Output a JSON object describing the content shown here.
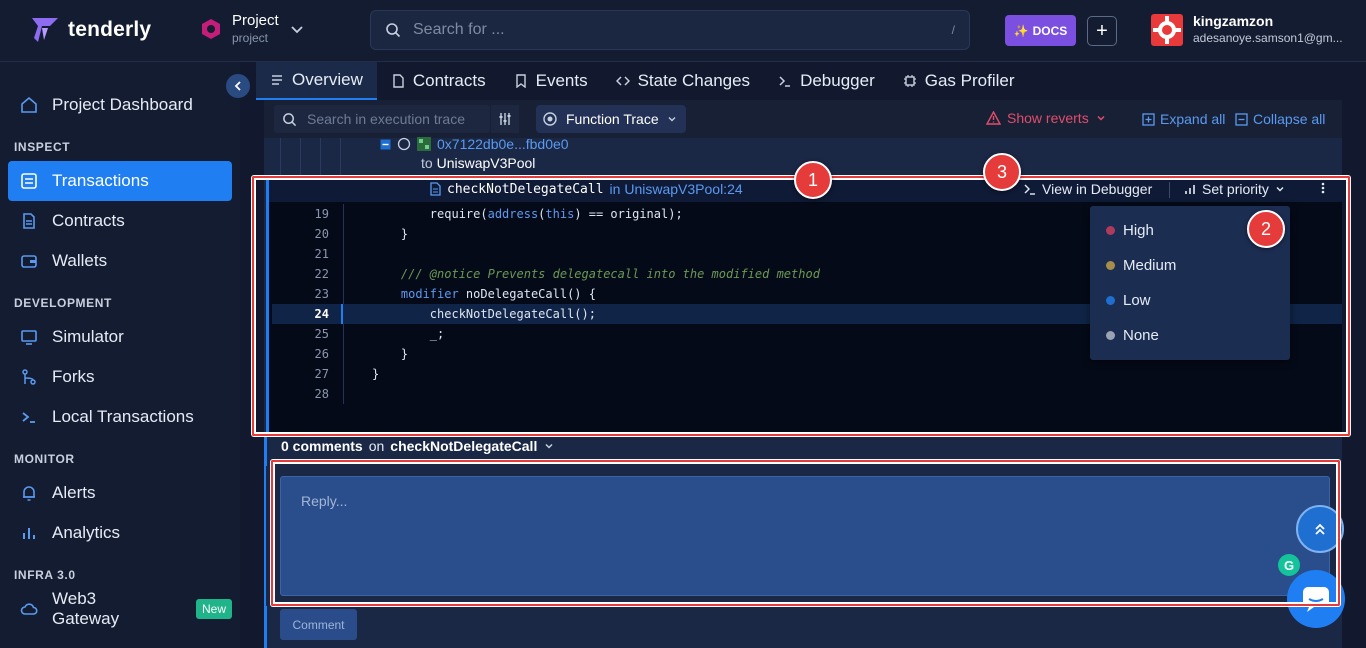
{
  "brand": {
    "name": "tenderly"
  },
  "project": {
    "name": "Project",
    "slug": "project"
  },
  "search": {
    "placeholder": "Search for ...",
    "shortcut": "/"
  },
  "header": {
    "docs_label": "DOCS",
    "add_label": "+"
  },
  "user": {
    "name": "kingzamzon",
    "email": "adesanoye.samson1@gm..."
  },
  "sidebar": {
    "dashboard": "Project Dashboard",
    "sections": {
      "inspect": "INSPECT",
      "development": "DEVELOPMENT",
      "monitor": "MONITOR",
      "infra": "INFRA 3.0"
    },
    "items": {
      "transactions": "Transactions",
      "contracts": "Contracts",
      "wallets": "Wallets",
      "simulator": "Simulator",
      "forks": "Forks",
      "local_transactions": "Local Transactions",
      "alerts": "Alerts",
      "analytics": "Analytics",
      "web3_gateway": "Web3 Gateway"
    },
    "new_badge": "New"
  },
  "tabs": [
    "Overview",
    "Contracts",
    "Events",
    "State Changes",
    "Debugger",
    "Gas Profiler"
  ],
  "toolbar": {
    "search_placeholder": "Search in execution trace",
    "function_trace": "Function Trace",
    "show_reverts": "Show reverts",
    "expand_all": "Expand all",
    "collapse_all": "Collapse all"
  },
  "trace": {
    "address": "0x7122db0e...fbd0e0",
    "to_label": "to",
    "to_contract": "UniswapV3Pool",
    "function": "checkNotDelegateCall",
    "in_label": "in",
    "location": "UniswapV3Pool:24",
    "view_in_debugger": "View in Debugger",
    "set_priority": "Set priority"
  },
  "code": {
    "lines": [
      {
        "n": "19",
        "t": "        require(address(this) == original);"
      },
      {
        "n": "20",
        "t": "    }"
      },
      {
        "n": "21",
        "t": ""
      },
      {
        "n": "22",
        "t": "    /// @notice Prevents delegatecall into the modified method"
      },
      {
        "n": "23",
        "t": "    modifier noDelegateCall() {"
      },
      {
        "n": "24",
        "t": "        checkNotDelegateCall();"
      },
      {
        "n": "25",
        "t": "        _;"
      },
      {
        "n": "26",
        "t": "    }"
      },
      {
        "n": "27",
        "t": "}"
      },
      {
        "n": "28",
        "t": ""
      }
    ],
    "highlighted_line": "24"
  },
  "priority_menu": {
    "options": [
      {
        "label": "High",
        "color": "#b03a5b"
      },
      {
        "label": "Medium",
        "color": "#a88d4a"
      },
      {
        "label": "Low",
        "color": "#1f6fd1"
      },
      {
        "label": "None",
        "color": "#9aa3b3"
      }
    ]
  },
  "comments": {
    "count": "0 comments",
    "on_label": "on",
    "target": "checkNotDelegateCall",
    "reply_placeholder": "Reply...",
    "comment_button": "Comment"
  },
  "annotations": [
    "1",
    "2",
    "3"
  ],
  "colors": {
    "accent": "#1f7ff2",
    "docs": "#7b4fe0",
    "reverts": "#e24d6a",
    "annotation": "#e53b3b"
  }
}
